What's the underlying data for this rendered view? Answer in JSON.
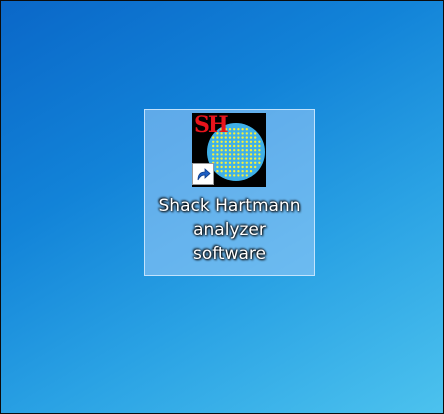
{
  "desktop": {
    "icons": [
      {
        "badge_text": "SH",
        "icon_name": "shack-hartmann-app-icon",
        "shortcut_icon_name": "shortcut-arrow-icon",
        "label_lines": [
          "Shack Hartmann",
          "analyzer",
          "software"
        ],
        "selected": true
      }
    ]
  },
  "colors": {
    "badge_red": "#e8141c",
    "lens_fill": "#3fb0e8",
    "spot_yellow": "#f6f03a"
  }
}
